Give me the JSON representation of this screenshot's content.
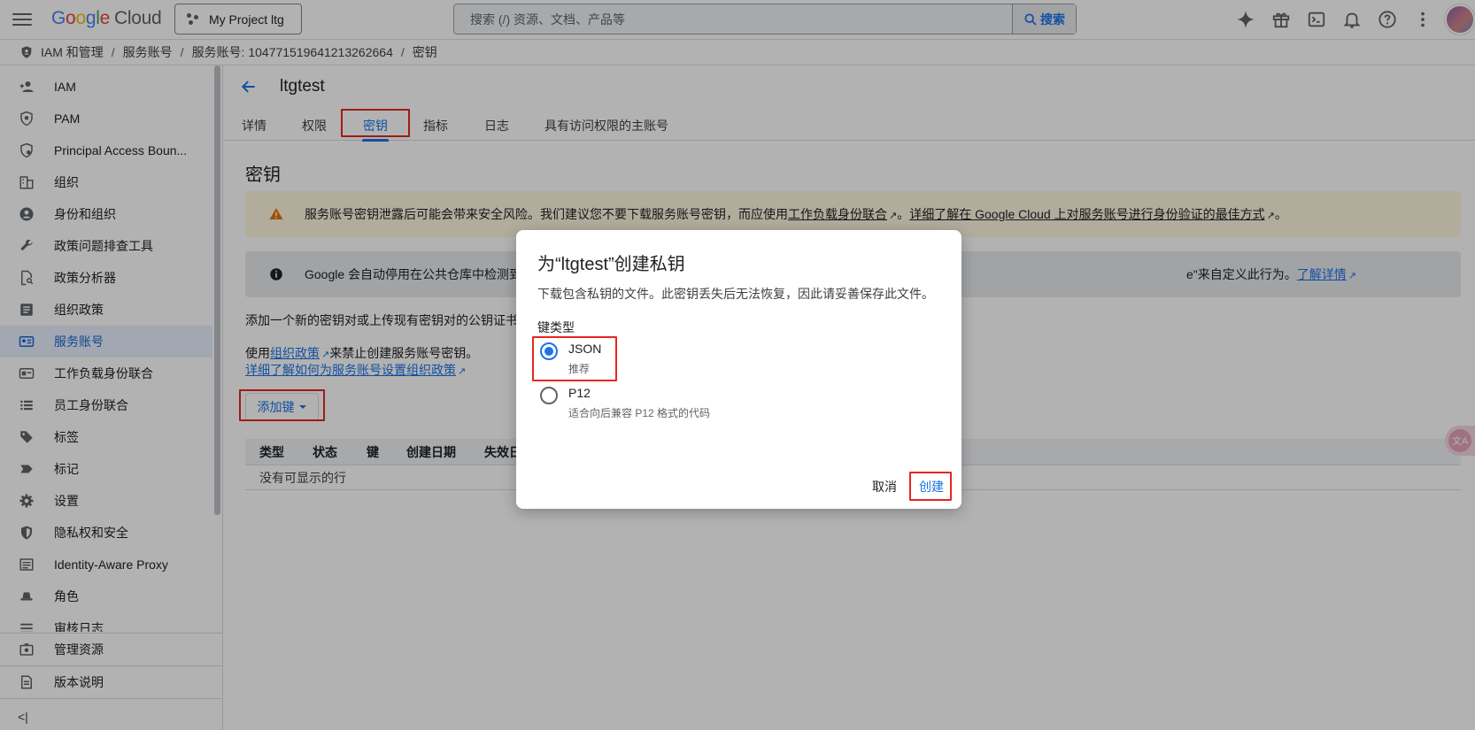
{
  "header": {
    "logo_google": "Google",
    "logo_cloud": "Cloud",
    "project": "My Project ltg",
    "search_placeholder": "搜索 (/) 资源、文档、产品等",
    "search_button": "搜索"
  },
  "breadcrumb": [
    "IAM 和管理",
    "服务账号",
    "服务账号: 104771519641213262664",
    "密钥"
  ],
  "sidebar": {
    "items": [
      {
        "label": "IAM",
        "icon": "person-add-icon"
      },
      {
        "label": "PAM",
        "icon": "shield-icon"
      },
      {
        "label": "Principal Access Boun...",
        "icon": "shield-search-icon"
      },
      {
        "label": "组织",
        "icon": "building-icon"
      },
      {
        "label": "身份和组织",
        "icon": "account-circle-icon"
      },
      {
        "label": "政策问题排查工具",
        "icon": "wrench-icon"
      },
      {
        "label": "政策分析器",
        "icon": "document-search-icon"
      },
      {
        "label": "组织政策",
        "icon": "list-document-icon"
      },
      {
        "label": "服务账号",
        "icon": "service-account-icon"
      },
      {
        "label": "工作负载身份联合",
        "icon": "id-card-icon"
      },
      {
        "label": "员工身份联合",
        "icon": "list-icon"
      },
      {
        "label": "标签",
        "icon": "tag-icon"
      },
      {
        "label": "标记",
        "icon": "label-icon"
      },
      {
        "label": "设置",
        "icon": "gear-icon"
      },
      {
        "label": "隐私权和安全",
        "icon": "shield-lock-icon"
      },
      {
        "label": "Identity-Aware Proxy",
        "icon": "iap-icon"
      },
      {
        "label": "角色",
        "icon": "hat-icon"
      },
      {
        "label": "审核日志",
        "icon": "list-icon"
      }
    ],
    "active_index": 8,
    "manage_resources": "管理资源",
    "release_notes": "版本说明",
    "collapse": "<|"
  },
  "main": {
    "title": "ltgtest",
    "tabs": [
      "详情",
      "权限",
      "密钥",
      "指标",
      "日志",
      "具有访问权限的主账号"
    ],
    "active_tab": "密钥",
    "section_title": "密钥",
    "warning": {
      "text1": "服务账号密钥泄露后可能会带来安全风险。我们建议您不要下载服务账号密钥，而应使用",
      "link1": "工作负载身份联合",
      "text2": "。",
      "link2": "详细了解在 Google Cloud 上对服务账号进行身份验证的最佳方式",
      "text3": "。"
    },
    "info": {
      "text1": "Google 会自动停用在公共仓库中检测到",
      "text2": "e\"来自定义此行为。",
      "link": "了解详情"
    },
    "add_desc": "添加一个新的密钥对或上传现有密钥对的公钥证书",
    "policy_text1": "使用",
    "policy_link": "组织政策",
    "policy_text2": "来禁止创建服务账号密钥。",
    "policy_learn": "详细了解如何为服务账号设置组织政策",
    "add_key_button": "添加键",
    "table_headers": [
      "类型",
      "状态",
      "键",
      "创建日期",
      "失效日"
    ],
    "table_empty": "没有可显示的行"
  },
  "dialog": {
    "title": "为“ltgtest”创建私钥",
    "description": "下载包含私钥的文件。此密钥丢失后无法恢复，因此请妥善保存此文件。",
    "key_type_label": "键类型",
    "options": [
      {
        "label": "JSON",
        "sub": "推荐",
        "checked": true
      },
      {
        "label": "P12",
        "sub": "适合向后兼容 P12 格式的代码",
        "checked": false
      }
    ],
    "cancel": "取消",
    "create": "创建"
  },
  "floating_badge": "文A",
  "colors": {
    "accent": "#1a73e8",
    "highlight": "#e52620",
    "warning_bg": "#fef7e0"
  }
}
